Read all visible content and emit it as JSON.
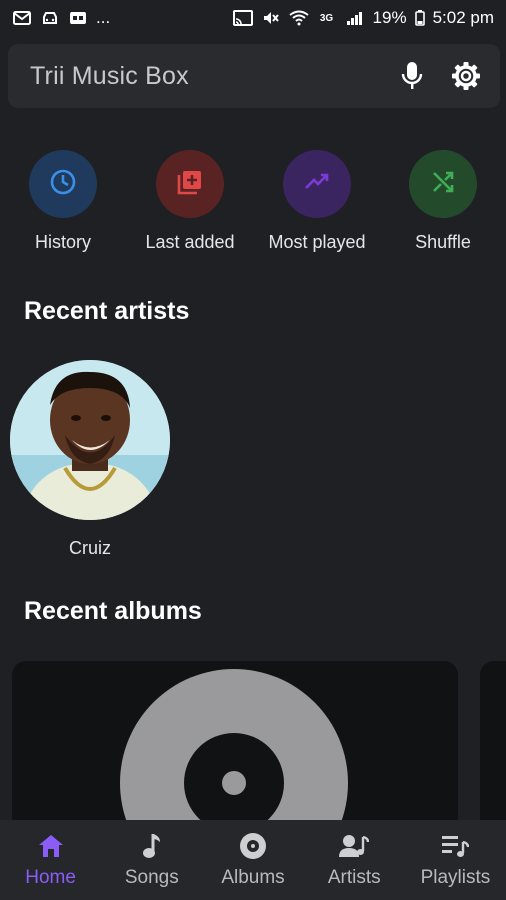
{
  "status_bar": {
    "battery": "19%",
    "time": "5:02 pm",
    "network": "3G",
    "overflow": "..."
  },
  "search": {
    "title": "Trii Music Box",
    "mic_icon": "mic-icon",
    "settings_icon": "gear-icon"
  },
  "shortcuts": [
    {
      "label": "History",
      "icon": "clock-icon",
      "bg": "#1f3a5c",
      "fg": "#3b8fe6"
    },
    {
      "label": "Last added",
      "icon": "library-add-icon",
      "bg": "#5a2323",
      "fg": "#e04848"
    },
    {
      "label": "Most played",
      "icon": "trending-up-icon",
      "bg": "#3a2560",
      "fg": "#7c3bd6"
    },
    {
      "label": "Shuffle",
      "icon": "shuffle-icon",
      "bg": "#244a2c",
      "fg": "#3fae54"
    }
  ],
  "sections": {
    "recent_artists": "Recent artists",
    "recent_albums": "Recent albums"
  },
  "artists": [
    {
      "name": "Cruiz"
    }
  ],
  "bottom_nav": [
    {
      "label": "Home",
      "icon": "home-icon",
      "active": true
    },
    {
      "label": "Songs",
      "icon": "music-note-icon",
      "active": false
    },
    {
      "label": "Albums",
      "icon": "album-icon",
      "active": false
    },
    {
      "label": "Artists",
      "icon": "artist-icon",
      "active": false
    },
    {
      "label": "Playlists",
      "icon": "playlist-icon",
      "active": false
    }
  ],
  "colors": {
    "accent": "#8b5cf6",
    "background": "#1f2023"
  }
}
